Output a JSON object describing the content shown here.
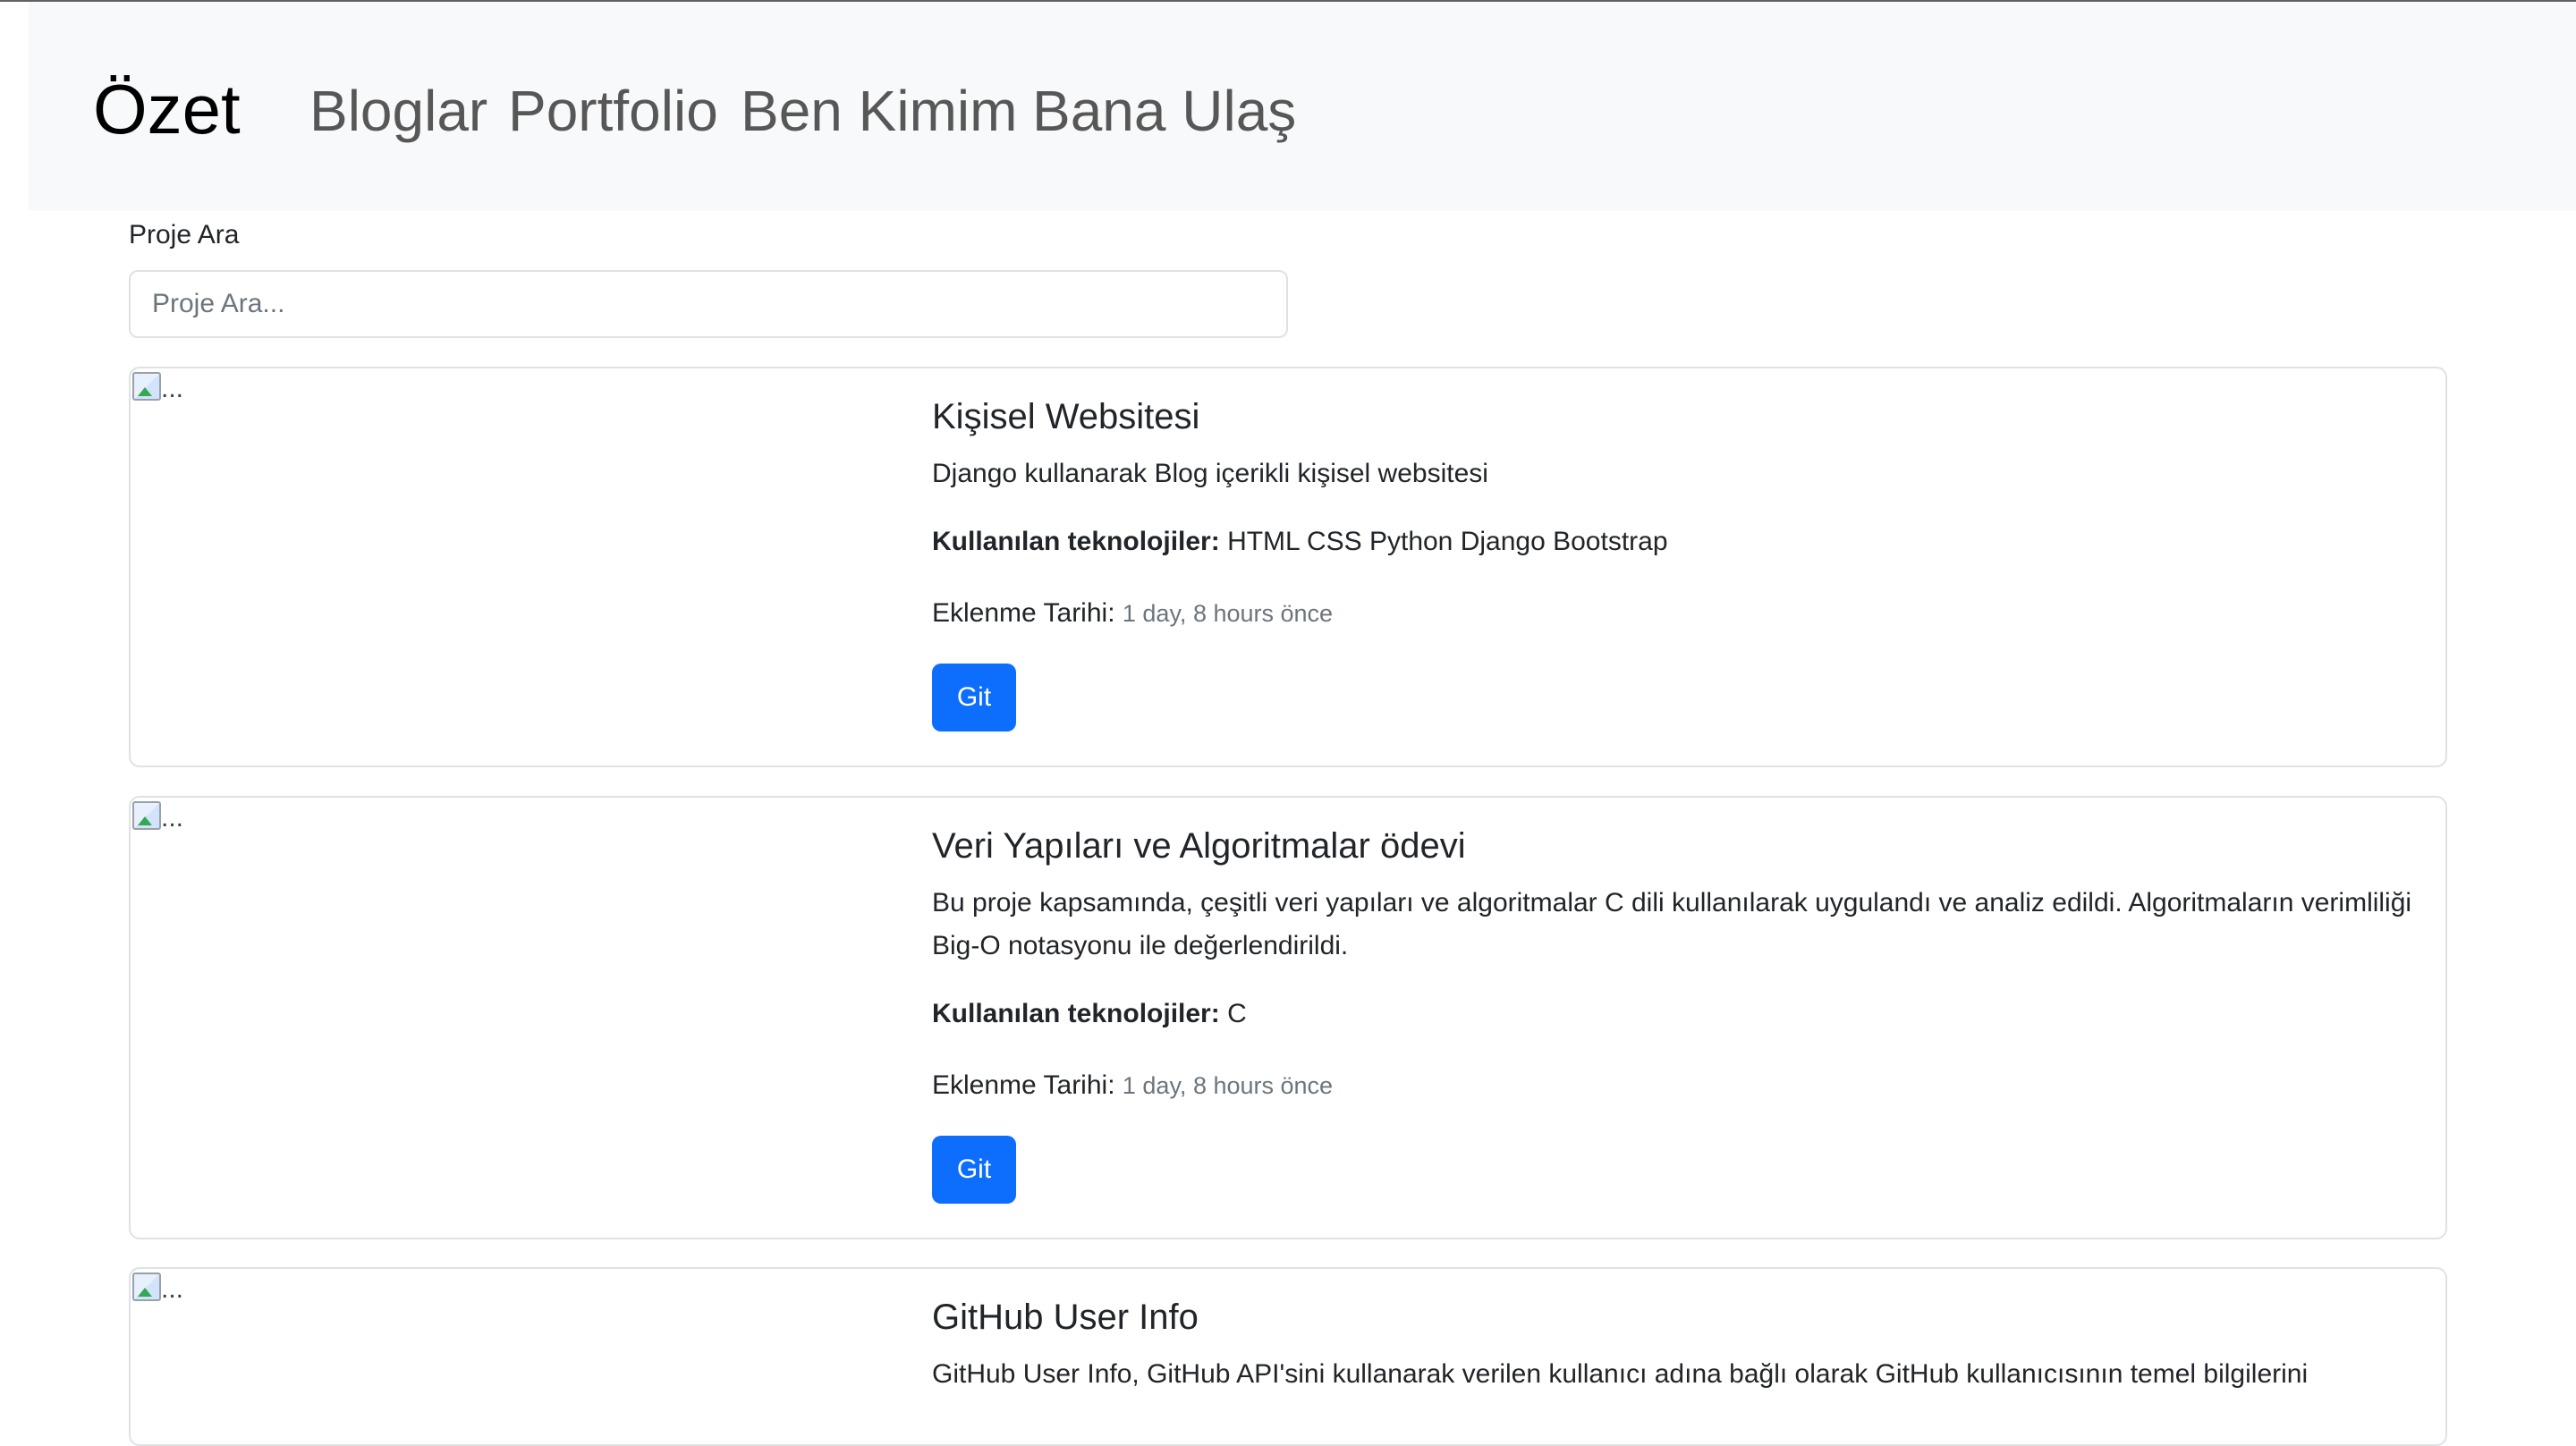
{
  "navbar": {
    "brand": "Özet",
    "links": [
      "Bloglar",
      "Portfolio",
      "Ben Kimim",
      "Bana Ulaş"
    ]
  },
  "search": {
    "label": "Proje Ara",
    "placeholder": "Proje Ara..."
  },
  "labels": {
    "tech_prefix": "Kullanılan teknolojiler:",
    "date_prefix": "Eklenme Tarihi:",
    "button": "Git",
    "image_alt": "..."
  },
  "projects": [
    {
      "title": "Kişisel Websitesi",
      "description": "Django kullanarak Blog içerikli kişisel websitesi",
      "technologies": "HTML CSS Python Django Bootstrap",
      "date": "1 day, 8 hours önce"
    },
    {
      "title": "Veri Yapıları ve Algoritmalar ödevi",
      "description": "Bu proje kapsamında, çeşitli veri yapıları ve algoritmalar C dili kullanılarak uygulandı ve analiz edildi. Algoritmaların verimliliği Big-O notasyonu ile değerlendirildi.",
      "technologies": "C",
      "date": "1 day, 8 hours önce"
    },
    {
      "title": "GitHub User Info",
      "description": "GitHub User Info, GitHub API'sini kullanarak verilen kullanıcı adına bağlı olarak GitHub kullanıcısının temel bilgilerini",
      "technologies": "",
      "date": ""
    }
  ],
  "colors": {
    "navbar_bg": "#f8f9fa",
    "button_bg": "#0d6efd",
    "border": "#dee2e6"
  }
}
